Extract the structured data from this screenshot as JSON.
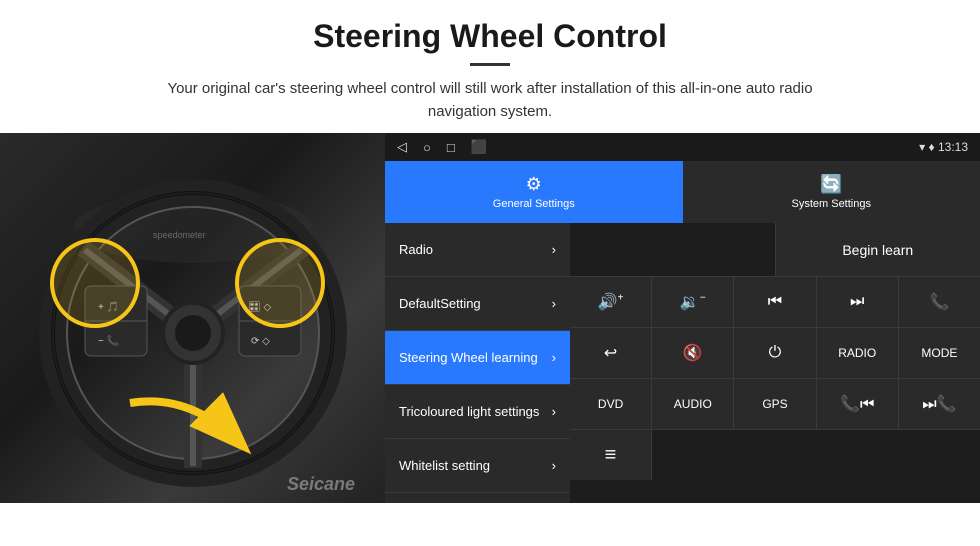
{
  "header": {
    "title": "Steering Wheel Control",
    "subtitle": "Your original car's steering wheel control will still work after installation of this all-in-one auto radio navigation system."
  },
  "status_bar": {
    "icons": [
      "◁",
      "○",
      "□",
      "⬛"
    ],
    "right_text": "▾  ♦  13:13"
  },
  "tabs": [
    {
      "id": "general",
      "label": "General Settings",
      "icon": "⚙",
      "active": true
    },
    {
      "id": "system",
      "label": "System Settings",
      "icon": "🔄",
      "active": false
    }
  ],
  "menu_items": [
    {
      "id": "radio",
      "label": "Radio",
      "active": false
    },
    {
      "id": "default",
      "label": "DefaultSetting",
      "active": false
    },
    {
      "id": "steering",
      "label": "Steering Wheel learning",
      "active": true
    },
    {
      "id": "tricoloured",
      "label": "Tricoloured light settings",
      "active": false
    },
    {
      "id": "whitelist",
      "label": "Whitelist setting",
      "active": false
    }
  ],
  "panel": {
    "begin_learn_label": "Begin learn",
    "rows": [
      [
        {
          "id": "vol-up",
          "icon": "🔊+",
          "label": "VOL+"
        },
        {
          "id": "vol-down",
          "icon": "🔉-",
          "label": "VOL−"
        },
        {
          "id": "prev-track",
          "icon": "⏮",
          "label": "PREV"
        },
        {
          "id": "next-track",
          "icon": "⏭",
          "label": "NEXT"
        },
        {
          "id": "call",
          "icon": "📞",
          "label": "CALL"
        }
      ],
      [
        {
          "id": "hang-up",
          "icon": "↩",
          "label": "HANG"
        },
        {
          "id": "mute",
          "icon": "🔇",
          "label": "MUTE"
        },
        {
          "id": "power",
          "icon": "⏻",
          "label": "PWR"
        },
        {
          "id": "radio-btn",
          "icon": "",
          "label": "RADIO"
        },
        {
          "id": "mode",
          "icon": "",
          "label": "MODE"
        }
      ],
      [
        {
          "id": "dvd",
          "icon": "",
          "label": "DVD"
        },
        {
          "id": "audio",
          "icon": "",
          "label": "AUDIO"
        },
        {
          "id": "gps",
          "icon": "",
          "label": "GPS"
        },
        {
          "id": "prev2",
          "icon": "📞⏮",
          "label": "TEL PREV"
        },
        {
          "id": "next2",
          "icon": "⏭📞",
          "label": "TEL NEXT"
        }
      ]
    ],
    "last_row_icon": "≡"
  },
  "watermark": "Seicane"
}
